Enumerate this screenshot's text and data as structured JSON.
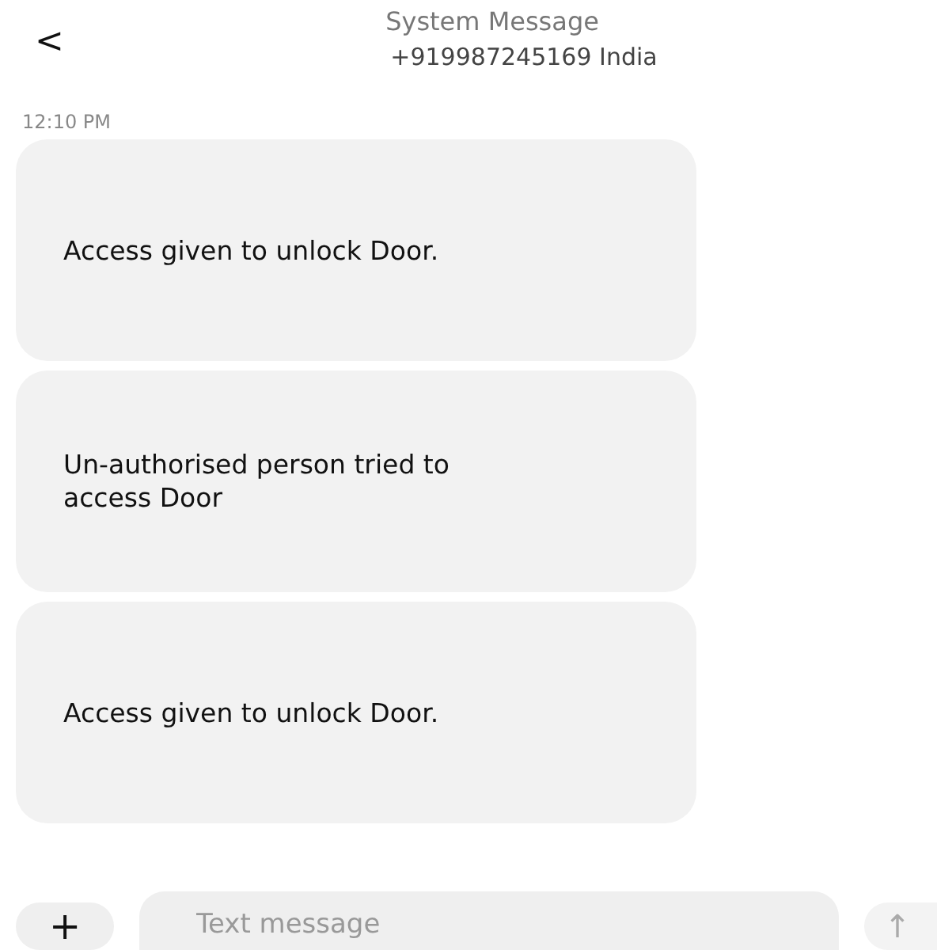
{
  "header": {
    "back": "<",
    "title": "System Message",
    "subtitle": "+919987245169 India"
  },
  "timestamp": "12:10 PM",
  "messages": [
    {
      "text": "Access given to unlock Door."
    },
    {
      "text": "Un-authorised person tried to access Door"
    },
    {
      "text": "Access given to unlock Door."
    }
  ],
  "composer": {
    "attach": "+",
    "placeholder": "Text message",
    "send": "↑"
  }
}
